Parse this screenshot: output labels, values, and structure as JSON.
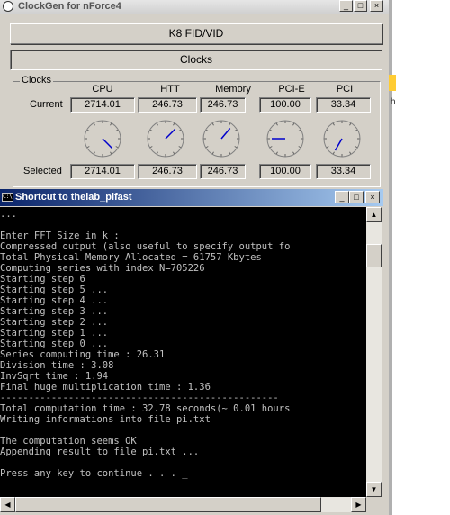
{
  "clockgen": {
    "title": "ClockGen for nForce4",
    "controls": {
      "minimize": "_",
      "maximize": "□",
      "close": "×"
    },
    "k8_button": "K8 FID/VID",
    "clocks_button": "Clocks",
    "group_label": "Clocks",
    "columns": [
      "CPU",
      "HTT",
      "Memory",
      "PCI-E",
      "PCI"
    ],
    "current_label": "Current",
    "selected_label": "Selected",
    "current": [
      "2714.01",
      "246.73",
      "246.73",
      "100.00",
      "33.34"
    ],
    "selected": [
      "2714.01",
      "246.73",
      "246.73",
      "100.00",
      "33.34"
    ],
    "gauge_angles_deg": [
      135,
      45,
      40,
      270,
      210
    ],
    "side_text": "h"
  },
  "console": {
    "title": "Shortcut to thelab_pifast",
    "icon_text": "C:\\",
    "controls": {
      "minimize": "_",
      "maximize": "□",
      "close": "×"
    },
    "lines": [
      "...",
      "",
      "Enter FFT Size in k :",
      "Compressed output (also useful to specify output fo",
      "Total Physical Memory Allocated = 61757 Kbytes",
      "Computing series with index N=705226",
      "Starting step 6",
      "Starting step 5 ...",
      "Starting step 4 ...",
      "Starting step 3 ...",
      "Starting step 2 ...",
      "Starting step 1 ...",
      "Starting step 0 ...",
      "Series computing time : 26.31",
      "Division time : 3.08",
      "InvSqrt time : 1.94",
      "Final huge multiplication time : 1.36",
      "-------------------------------------------------",
      "Total computation time : 32.78 seconds(~ 0.01 hours",
      "Writing informations into file pi.txt",
      "",
      "The computation seems OK",
      "Appending result to file pi.txt ...",
      "",
      "Press any key to continue . . . _"
    ]
  }
}
